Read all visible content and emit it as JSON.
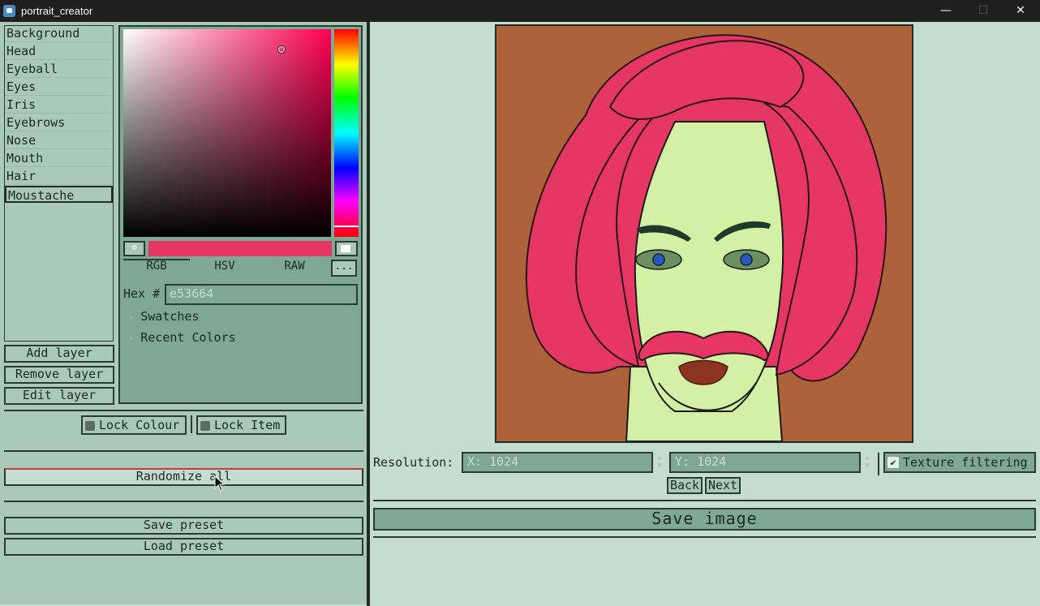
{
  "window": {
    "title": "portrait_creator",
    "minimize_icon": "minimize-icon",
    "maximize_icon": "maximize-icon",
    "close_icon": "close-icon"
  },
  "layers": {
    "items": [
      "Background",
      "Head",
      "Eyeball",
      "Eyes",
      "Iris",
      "Eyebrows",
      "Nose",
      "Mouth",
      "Hair",
      "Moustache"
    ],
    "selected": "Moustache",
    "add_label": "Add layer",
    "remove_label": "Remove layer",
    "edit_label": "Edit layer"
  },
  "color_picker": {
    "current_color": "#e53664",
    "modes": [
      "RGB",
      "HSV",
      "RAW"
    ],
    "active_mode": "RGB",
    "more_label": "...",
    "hex_label": "Hex #",
    "hex_value": "e53664",
    "swatches_label": "Swatches",
    "recent_label": "Recent Colors",
    "eyedropper_icon": "eyedropper-icon"
  },
  "locks": {
    "lock_colour_label": "Lock Colour",
    "lock_item_label": "Lock Item"
  },
  "actions": {
    "randomize_label": "Randomize all",
    "save_preset_label": "Save preset",
    "load_preset_label": "Load preset"
  },
  "output": {
    "resolution_label": "Resolution:",
    "x_value": "X: 1024",
    "y_value": "Y: 1024",
    "texture_filtering_label": "Texture filtering",
    "texture_filtering_checked": true,
    "back_label": "Back",
    "next_label": "Next",
    "save_image_label": "Save image"
  },
  "portrait": {
    "background_color": "#ad623a",
    "skin_color": "#d3f0a5",
    "hair_color": "#e53664",
    "iris_color": "#2a58b8",
    "lip_color": "#8c3420"
  }
}
